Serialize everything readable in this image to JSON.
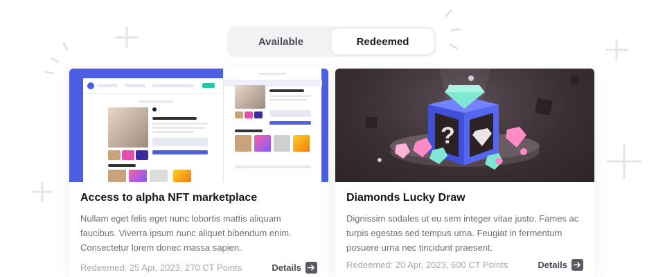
{
  "toggle": {
    "tabs": [
      {
        "label": "Available",
        "active": false
      },
      {
        "label": "Redeemed",
        "active": true
      }
    ]
  },
  "cards": [
    {
      "title": "Access to alpha NFT marketplace",
      "description": "Nullam eget felis eget nunc lobortis mattis aliquam faucibus. Viverra ipsum nunc aliquet bibendum enim. Consectetur lorem donec massa sapien.",
      "meta": "Redeemed: 25 Apr, 2023, 270 CT Points",
      "details_label": "Details",
      "image": "nft-gallery-screenshot"
    },
    {
      "title": "Diamonds Lucky Draw",
      "description": "Dignissim sodales ut eu sem integer vitae justo. Fames ac turpis egestas sed tempus urna. Feugiat in fermentum posuere urna nec tincidunt praesent.",
      "meta": "Redeemed: 20 Apr, 2023, 600 CT Points",
      "details_label": "Details",
      "image": "mystery-box-with-diamonds"
    }
  ],
  "colors": {
    "accent_blue": "#4c5fe2",
    "text_dark": "#17171f",
    "text_muted": "#6d6e78",
    "meta": "#a7a8b0",
    "toggle_bg": "#f1f2f4"
  },
  "icons": {
    "details_arrow": "arrow-right-icon",
    "decor": "sparkle-icon"
  }
}
